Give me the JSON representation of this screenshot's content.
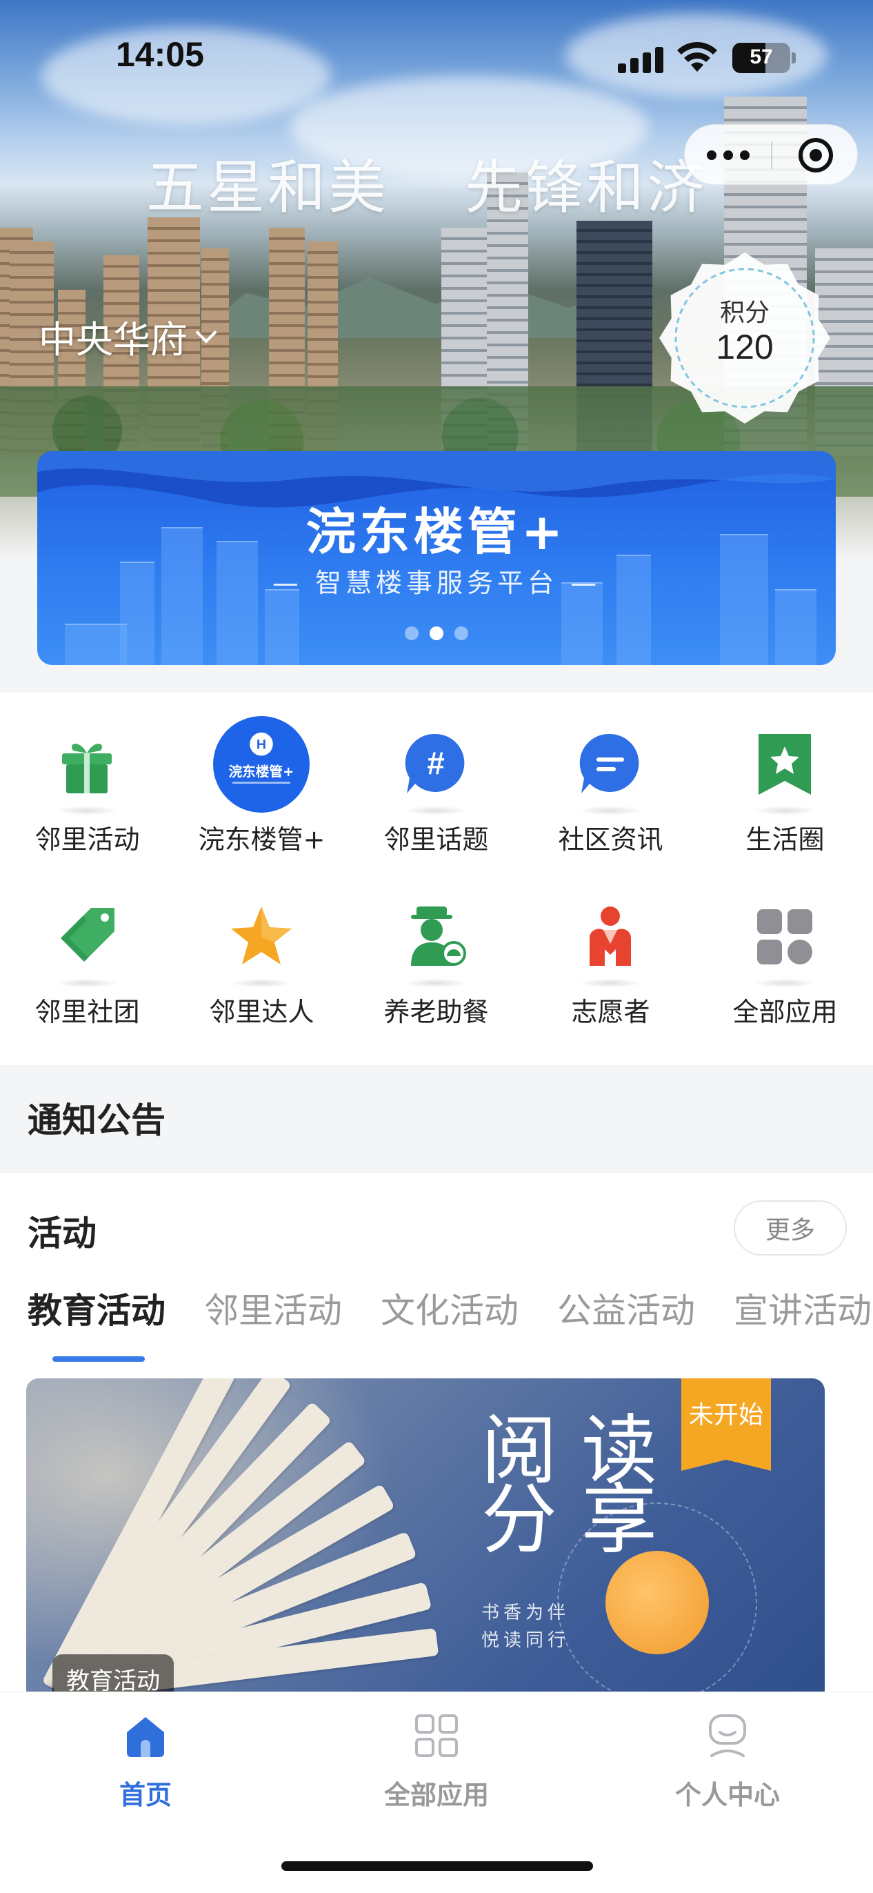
{
  "status_bar": {
    "time": "14:05",
    "battery": "57",
    "battery_level": 0.57
  },
  "hero": {
    "slogan": [
      "五星和美",
      "先锋和济"
    ],
    "community_name": "中央华府",
    "points": {
      "label": "积分",
      "value": "120"
    }
  },
  "banner": {
    "title": "浣东楼管+",
    "subtitle": "— 智慧楼事服务平台 —",
    "slide_count": 3,
    "active_slide": 2
  },
  "grid": [
    {
      "label": "邻里活动",
      "icon": "gift-icon"
    },
    {
      "label": "浣东楼管+",
      "icon": "logo-icon",
      "logo_text": "浣东楼管+"
    },
    {
      "label": "邻里话题",
      "icon": "hashtag-bubble-icon"
    },
    {
      "label": "社区资讯",
      "icon": "message-bubble-icon"
    },
    {
      "label": "生活圈",
      "icon": "star-bookmark-icon"
    },
    {
      "label": "邻里社团",
      "icon": "tag-icon"
    },
    {
      "label": "邻里达人",
      "icon": "star-icon"
    },
    {
      "label": "养老助餐",
      "icon": "elder-meal-icon"
    },
    {
      "label": "志愿者",
      "icon": "volunteer-icon"
    },
    {
      "label": "全部应用",
      "icon": "apps-grid-icon"
    }
  ],
  "notice": {
    "title": "通知公告"
  },
  "activity": {
    "title": "活动",
    "more_label": "更多",
    "tabs": [
      "教育活动",
      "邻里活动",
      "文化活动",
      "公益活动",
      "宣讲活动"
    ],
    "active_tab": 0,
    "card": {
      "status": "未开始",
      "category": "教育活动",
      "headline_top": "阅 读",
      "headline_bottom": "分 享",
      "tagline": [
        "书香为伴",
        "悦读同行"
      ]
    }
  },
  "bottom_nav": [
    {
      "label": "首页",
      "icon": "home-icon",
      "active": true
    },
    {
      "label": "全部应用",
      "icon": "apps-grid-icon",
      "active": false
    },
    {
      "label": "个人中心",
      "icon": "user-icon",
      "active": false
    }
  ],
  "colors": {
    "accent": "#2f6fdc",
    "status_orange": "#f5a623",
    "banner_blue": "#2f7cf0"
  }
}
